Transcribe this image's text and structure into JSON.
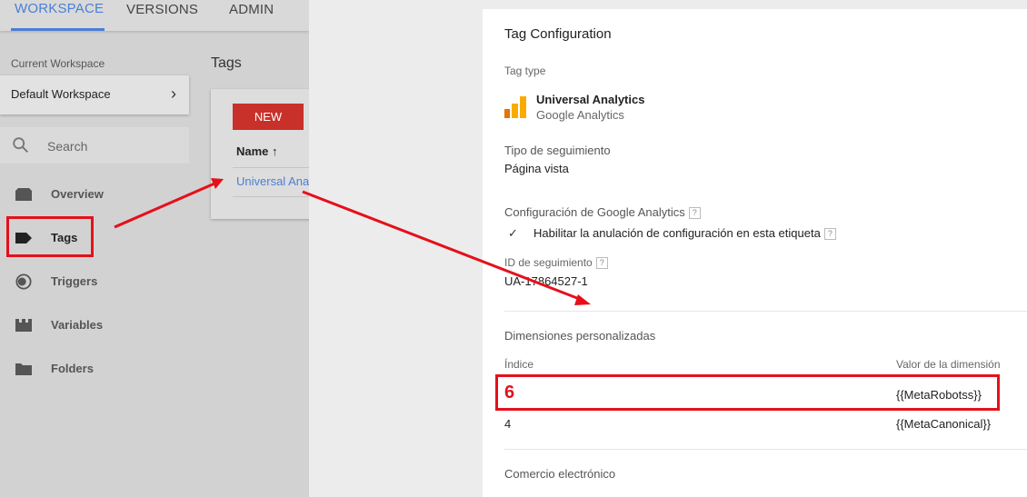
{
  "topnav": {
    "tabs": [
      {
        "label": "WORKSPACE",
        "active": true
      },
      {
        "label": "VERSIONS",
        "active": false
      },
      {
        "label": "ADMIN",
        "active": false
      }
    ]
  },
  "sidebar": {
    "current_workspace_label": "Current Workspace",
    "workspace_name": "Default Workspace",
    "search_placeholder": "Search",
    "items": [
      {
        "label": "Overview",
        "icon": "overview-icon"
      },
      {
        "label": "Tags",
        "icon": "tag-icon",
        "selected": true
      },
      {
        "label": "Triggers",
        "icon": "trigger-icon"
      },
      {
        "label": "Variables",
        "icon": "variables-icon"
      },
      {
        "label": "Folders",
        "icon": "folder-icon"
      }
    ]
  },
  "tags": {
    "title": "Tags",
    "new_button": "NEW",
    "column_name": "Name",
    "rows": [
      "Universal Ana"
    ]
  },
  "panel": {
    "title": "Tag Configuration",
    "tag_type_label": "Tag type",
    "tag_type_name": "Universal Analytics",
    "tag_type_vendor": "Google Analytics",
    "tracking_type_label": "Tipo de seguimiento",
    "tracking_type_value": "Página vista",
    "ga_settings_label": "Configuración de Google Analytics",
    "override_label": "Habilitar la anulación de configuración en esta etiqueta",
    "tracking_id_label": "ID de seguimiento",
    "tracking_id_value": "UA-17864527-1",
    "custom_dimensions_label": "Dimensiones personalizadas",
    "col_index": "Índice",
    "col_value": "Valor de la dimensión",
    "dimensions": [
      {
        "index": "6",
        "value": "{{MetaRobotss}}"
      },
      {
        "index": "4",
        "value": "{{MetaCanonical}}"
      }
    ],
    "ecommerce_label": "Comercio electrónico"
  },
  "colors": {
    "accent": "#4a7fd6",
    "new_button": "#c8302a",
    "annotation": "#e5101a",
    "ua_orange": "#f9ab00",
    "ua_orange_dark": "#e37400"
  }
}
